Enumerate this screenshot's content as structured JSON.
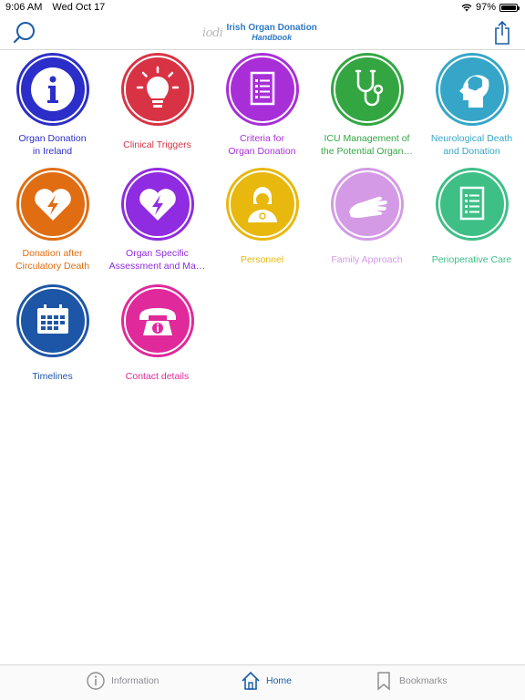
{
  "status": {
    "time": "9:06 AM",
    "date": "Wed Oct 17",
    "battery": "97%",
    "battery_level": 0.97
  },
  "header": {
    "logo_mark": "iodi",
    "title_line1": "Irish Organ Donation",
    "title_line2": "Handbook",
    "search_icon": "search-icon",
    "share_icon": "share-icon"
  },
  "tiles": [
    {
      "label": "Organ Donation\nin Ireland",
      "color": "#2b2ec8",
      "icon": "info-icon"
    },
    {
      "label": "Clinical Triggers",
      "color": "#d83344",
      "icon": "lightbulb-icon"
    },
    {
      "label": "Criteria for\nOrgan Donation",
      "color": "#a82fd8",
      "icon": "document-icon"
    },
    {
      "label": "ICU Management of\nthe Potential Organ…",
      "color": "#33a642",
      "icon": "stethoscope-icon"
    },
    {
      "label": "Neurological Death\nand Donation",
      "color": "#36a6c8",
      "icon": "head-brain-icon"
    },
    {
      "label": "Donation after\nCirculatory Death",
      "color": "#e06d12",
      "icon": "heart-lightning-icon"
    },
    {
      "label": "Organ Specific\nAssessment and Ma…",
      "color": "#8f2be0",
      "icon": "heart-lightning-icon"
    },
    {
      "label": "Personnel",
      "color": "#e8b80e",
      "icon": "doctor-icon"
    },
    {
      "label": "Family Approach",
      "color": "#d49ae6",
      "icon": "hand-icon"
    },
    {
      "label": "Perioperative Care",
      "color": "#3ebf86",
      "icon": "checklist-icon"
    },
    {
      "label": "Timelines",
      "color": "#1d56a6",
      "icon": "calendar-icon"
    },
    {
      "label": "Contact details",
      "color": "#e0299a",
      "icon": "phone-info-icon"
    }
  ],
  "tabbar": {
    "information": "Information",
    "home": "Home",
    "bookmarks": "Bookmarks",
    "active_color": "#1a5ea8"
  }
}
